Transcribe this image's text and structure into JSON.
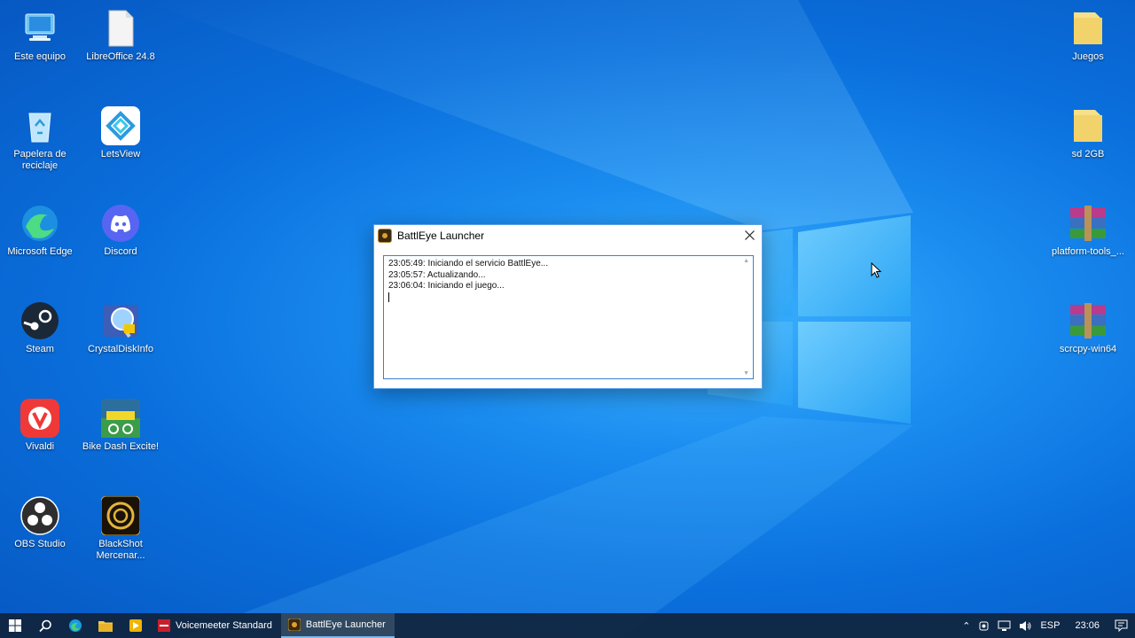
{
  "desktop": {
    "icons_left": [
      {
        "label": "Este equipo",
        "icon": "computer-icon"
      },
      {
        "label": "LibreOffice 24.8",
        "icon": "libreoffice-icon"
      },
      {
        "label": "Papelera de reciclaje",
        "icon": "recycle-bin-icon"
      },
      {
        "label": "LetsView",
        "icon": "letsview-icon"
      },
      {
        "label": "Microsoft Edge",
        "icon": "edge-icon"
      },
      {
        "label": "Discord",
        "icon": "discord-icon"
      },
      {
        "label": "Steam",
        "icon": "steam-icon"
      },
      {
        "label": "CrystalDiskInfo",
        "icon": "crystaldiskinfo-icon"
      },
      {
        "label": "Vivaldi",
        "icon": "vivaldi-icon"
      },
      {
        "label": "Bike Dash Excite!",
        "icon": "bike-dash-icon"
      },
      {
        "label": "OBS Studio",
        "icon": "obs-icon"
      },
      {
        "label": "BlackShot Mercenar...",
        "icon": "blackshot-icon"
      }
    ],
    "icons_right": [
      {
        "label": "Juegos",
        "icon": "folder-icon"
      },
      {
        "label": "sd 2GB",
        "icon": "folder-icon"
      },
      {
        "label": "platform-tools_...",
        "icon": "winrar-archive-icon"
      },
      {
        "label": "scrcpy-win64",
        "icon": "winrar-archive-icon"
      }
    ]
  },
  "dialog": {
    "title": "BattlEye Launcher",
    "log": [
      "23:05:49: Iniciando el servicio BattlEye...",
      "23:05:57: Actualizando...",
      "23:06:04: Iniciando el juego..."
    ]
  },
  "taskbar": {
    "apps": [
      {
        "label": "Voicemeeter Standard",
        "active": false
      },
      {
        "label": "BattlEye Launcher",
        "active": true
      }
    ],
    "tray": {
      "language": "ESP",
      "time": "23:06"
    }
  },
  "colors": {
    "accent": "#0a6fdc",
    "taskbar": "#10243c",
    "dialog_border": "#5aa0e8"
  }
}
